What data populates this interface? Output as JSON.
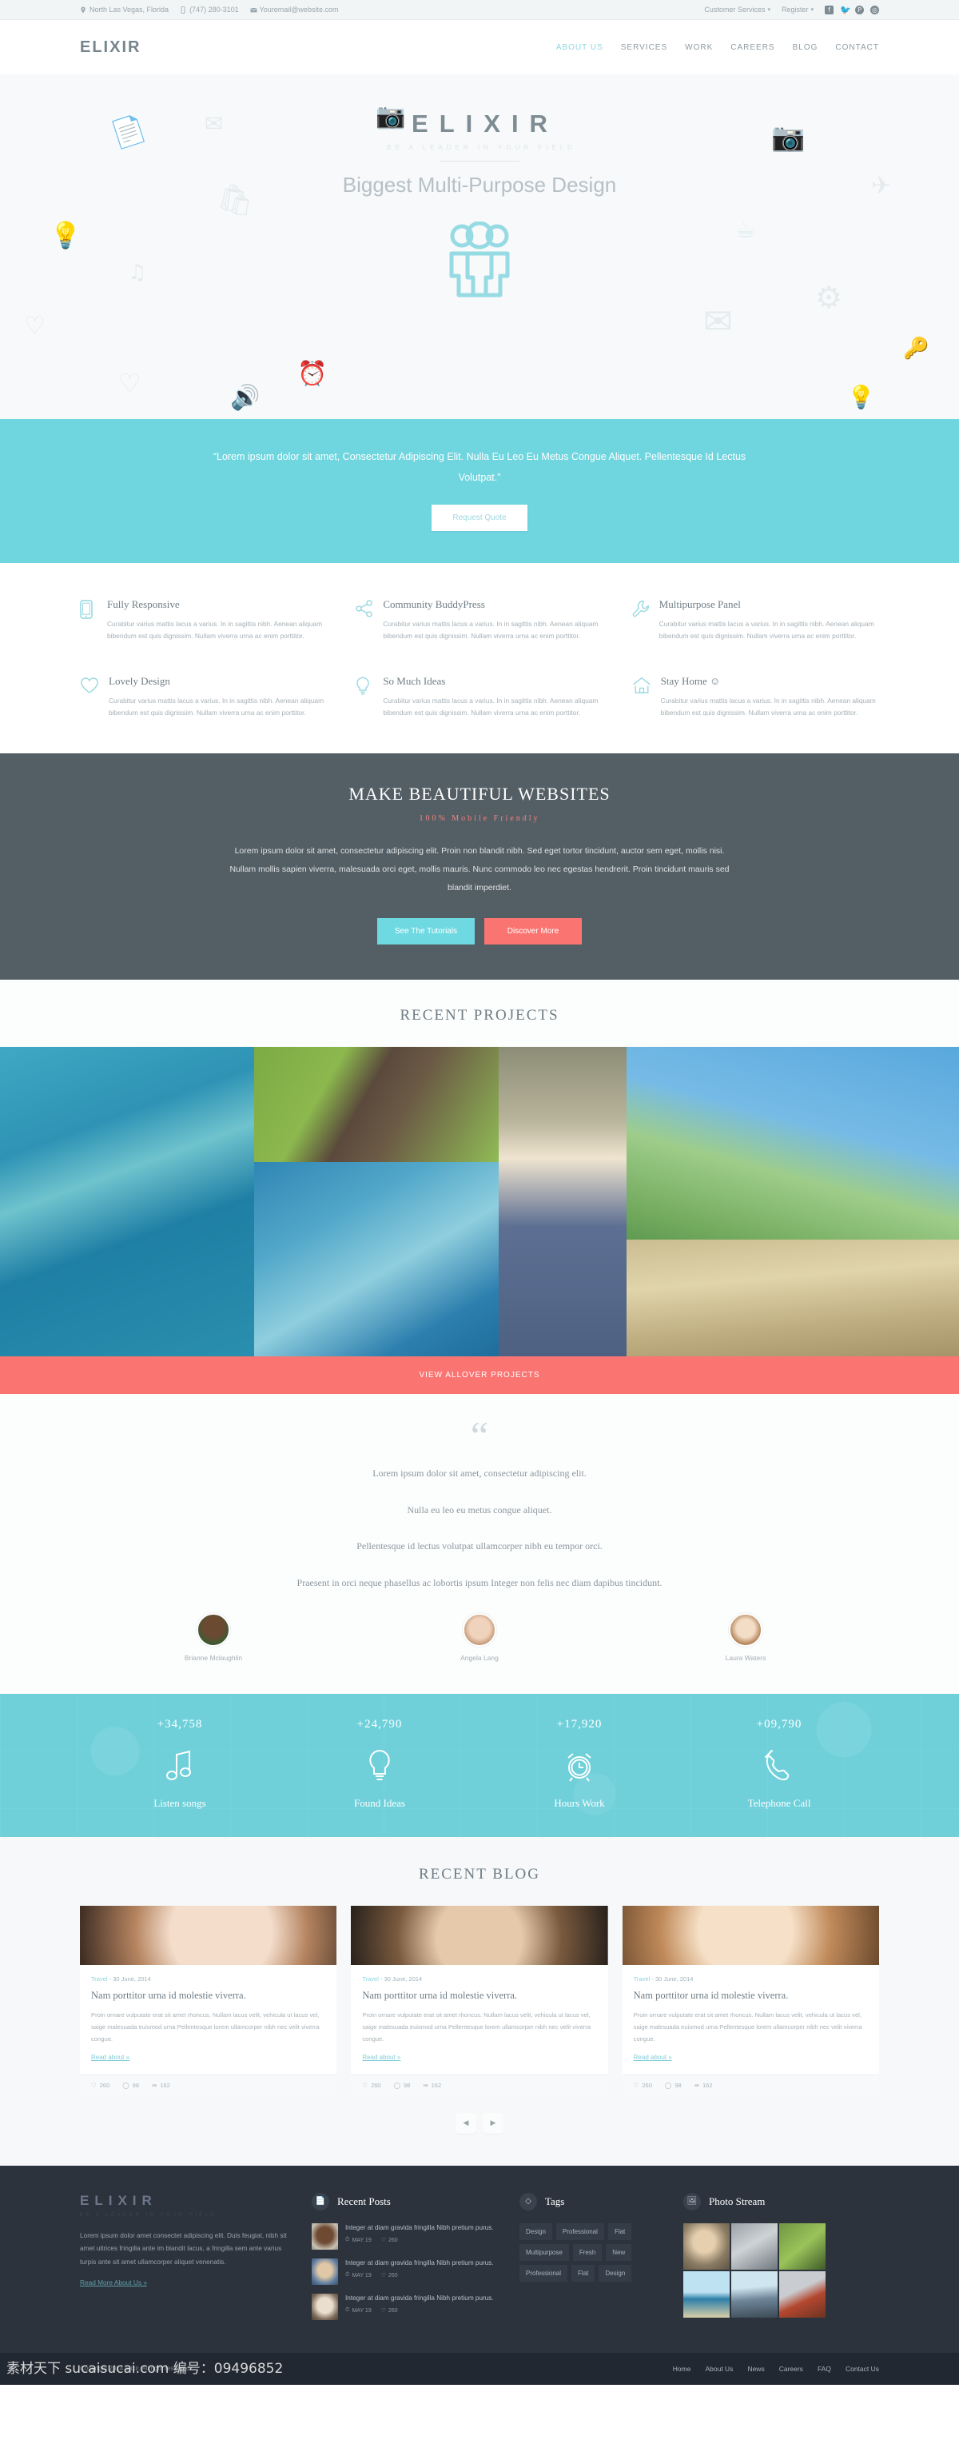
{
  "topbar": {
    "address": "North Las Vegas, Florida",
    "phone": "(747) 280-3101",
    "email": "Youremail@website.com",
    "customer_services": "Customer Services",
    "register": "Register",
    "socials": [
      "facebook-icon",
      "twitter-icon",
      "pinterest-icon",
      "dribbble-icon"
    ]
  },
  "header": {
    "brand": "ELIXIR",
    "nav": [
      {
        "label": "ABOUT US",
        "active": true
      },
      {
        "label": "SERVICES",
        "active": false
      },
      {
        "label": "WORK",
        "active": false
      },
      {
        "label": "CAREERS",
        "active": false
      },
      {
        "label": "BLOG",
        "active": false
      },
      {
        "label": "CONTACT",
        "active": false
      }
    ]
  },
  "hero": {
    "logo": "ELIXIR",
    "tagline": "BE A LEADER IN YOUR FIELD",
    "title": "Biggest Multi-Purpose Design",
    "icon": "group-people-icon",
    "accent": "#8ed8e0",
    "bg": "#f7f9fa"
  },
  "quoteband": {
    "text": "“Lorem ipsum dolor sit amet, Consectetur Adipiscing Elit. Nulla Eu Leo Eu Metus Congue Aliquet. Pellentesque Id Lectus Volutpat.”",
    "button": "Request Quote",
    "bg": "#6fd5de"
  },
  "features": [
    {
      "icon": "mobile-icon",
      "title": "Fully Responsive",
      "text": "Curabitur varius mattis lacus a varius. In in sagittis nibh. Aenean aliquam bibendum est quis dignissim. Nullam viverra urna ac enim porttitor."
    },
    {
      "icon": "share-icon",
      "title": "Community BuddyPress",
      "text": "Curabitur varius mattis lacus a varius. In in sagittis nibh. Aenean aliquam bibendum est quis dignissim. Nullam viverra urna ac enim porttitor."
    },
    {
      "icon": "wrench-icon",
      "title": "Multipurpose Panel",
      "text": "Curabitur varius mattis lacus a varius. In in sagittis nibh. Aenean aliquam bibendum est quis dignissim. Nullam viverra urna ac enim porttitor."
    },
    {
      "icon": "heart-icon",
      "title": "Lovely Design",
      "text": "Curabitur varius mattis lacus a varius. In in sagittis nibh. Aenean aliquam bibendum est quis dignissim. Nullam viverra urna ac enim porttitor."
    },
    {
      "icon": "bulb-icon",
      "title": "So Much Ideas",
      "text": "Curabitur varius mattis lacus a varius. In in sagittis nibh. Aenean aliquam bibendum est quis dignissim. Nullam viverra urna ac enim porttitor."
    },
    {
      "icon": "home-icon",
      "title": "Stay Home ☺",
      "text": "Curabitur varius mattis lacus a varius. In in sagittis nibh. Aenean aliquam bibendum est quis dignissim. Nullam viverra urna ac enim porttitor."
    }
  ],
  "darkcta": {
    "heading": "MAKE BEAUTIFUL WEBSITES",
    "subheading": "100% Mobile Friendly",
    "body": "Lorem ipsum dolor sit amet, consectetur adipiscing elit. Proin non blandit nibh. Sed eget tortor tincidunt, auctor sem eget, mollis nisi. Nullam mollis sapien viverra, malesuada orci eget, mollis mauris. Nunc commodo leo nec egestas hendrerit. Proin tincidunt mauris sed blandit imperdiet.",
    "btn_primary": "See The Tutorials",
    "btn_secondary": "Discover More",
    "bg": "#545f65",
    "primary_color": "#6fd9e2",
    "secondary_color": "#fa7572"
  },
  "projects": {
    "title": "RECENT PROJECTS",
    "view_all": "VIEW ALLOVER PROJECTS",
    "view_all_color": "#fa7572",
    "items": [
      {
        "alt": "surfers-riding-wave"
      },
      {
        "alt": "park-bench-under-trees"
      },
      {
        "alt": "blue-ocean-waves"
      },
      {
        "alt": "man-in-straw-hat"
      },
      {
        "alt": "two-people-walking-on-hill"
      },
      {
        "alt": "wheat-field-close-up"
      }
    ]
  },
  "testimonial": {
    "quote_mark": "“",
    "lines": [
      "Lorem ipsum dolor sit amet, consectetur adipiscing elit.",
      "Nulla eu leo eu metus congue aliquet.",
      "Pellentesque id lectus volutpat ullamcorper nibh eu tempor orci.",
      "Praesent in orci neque phasellus ac lobortis ipsum Integer non felis nec diam dapibus tincidunt."
    ],
    "people": [
      {
        "name": "Brianne Mclaughlin"
      },
      {
        "name": "Angela Lang"
      },
      {
        "name": "Laura Waters"
      }
    ]
  },
  "counters": {
    "bg": "#6fd0da",
    "items": [
      {
        "number": "+34,758",
        "icon": "music-note-icon",
        "label": "Listen songs"
      },
      {
        "number": "+24,790",
        "icon": "bulb-icon",
        "label": "Found Ideas"
      },
      {
        "number": "+17,920",
        "icon": "alarm-clock-icon",
        "label": "Hours Work"
      },
      {
        "number": "+09,790",
        "icon": "phone-icon",
        "label": "Telephone Call"
      }
    ]
  },
  "blog": {
    "title": "RECENT BLOG",
    "posts": [
      {
        "category": "Travel",
        "date": "30 June, 2014",
        "title": "Nam porttitor urna id molestie viverra.",
        "excerpt": "Proin ornare vulputate erat sit amet rhoncus. Nullam lacus velit, vehicula ut lacus vel, saige malesuada euismod urna Pellentesque  lorem ullamcorper nibh nec velit viverra congue.",
        "read_more": "Read about »",
        "likes": "260",
        "comments": "98",
        "shares": "162"
      },
      {
        "category": "Travel",
        "date": "30 June, 2014",
        "title": "Nam porttitor urna id molestie viverra.",
        "excerpt": "Proin ornare vulputate erat sit amet rhoncus. Nullam lacus velit, vehicula ut lacus vel, saige malesuada euismod urna Pellentesque  lorem ullamcorper nibh nec velit viverra congue.",
        "read_more": "Read about »",
        "likes": "260",
        "comments": "98",
        "shares": "162"
      },
      {
        "category": "Travel",
        "date": "30 June, 2014",
        "title": "Nam porttitor urna id molestie viverra.",
        "excerpt": "Proin ornare vulputate erat sit amet rhoncus. Nullam lacus velit, vehicula ut lacus vel, saige malesuada euismod urna Pellentesque  lorem ullamcorper nibh nec velit viverra congue.",
        "read_more": "Read about »",
        "likes": "260",
        "comments": "98",
        "shares": "162"
      }
    ],
    "prev": "◀",
    "next": "▶"
  },
  "footer": {
    "brand": "ELIXIR",
    "brand_tagline": "BE A LEADER IN YOUR FIELD",
    "about": "Lorem ipsum dolor amet consectet adipiscing elit. Duis feugiat, nibh sit amet ultrices fringilla ante im blandit lacus, a fringilla sem ante varius turpis ante sit amet ullamcorper aliquet venenatis.",
    "read_more": "Read More About Us »",
    "recent_posts": {
      "title": "Recent Posts",
      "icon": "document-icon",
      "items": [
        {
          "text": "Integer at diam gravida fringilla Nibh pretium purus.",
          "date": "MAY 19",
          "likes": "260"
        },
        {
          "text": "Integer at diam gravida fringilla Nibh pretium purus.",
          "date": "MAY 19",
          "likes": "260"
        },
        {
          "text": "Integer at diam gravida fringilla Nibh pretium purus.",
          "date": "MAY 19",
          "likes": "260"
        }
      ]
    },
    "tags": {
      "title": "Tags",
      "icon": "tag-icon",
      "items": [
        "Design",
        "Professional",
        "Flat",
        "Multipurpose",
        "Fresh",
        "New",
        "Professional",
        "Flat",
        "Design"
      ]
    },
    "photo_stream": {
      "title": "Photo Stream",
      "icon": "image-icon",
      "count": 6
    },
    "copyright": "Copyright 2014 Elixir. All right reserved.",
    "bottom_nav": [
      "Home",
      "About Us",
      "News",
      "Careers",
      "FAQ",
      "Contact Us"
    ],
    "watermark": "素材天下 sucaisucai.com 编号：09496852"
  }
}
